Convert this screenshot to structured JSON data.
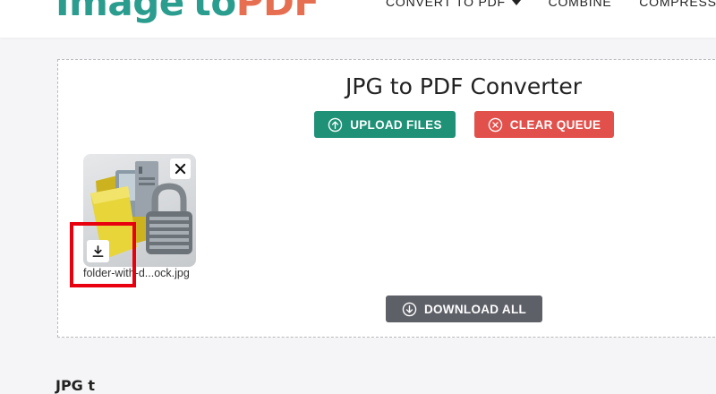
{
  "header": {
    "logo": {
      "part1": "Image",
      "part2": "to",
      "part3": "PDF"
    },
    "nav": [
      {
        "label": "CONVERT TO PDF"
      },
      {
        "label": "COMBINE"
      },
      {
        "label": "COMPRESS"
      }
    ]
  },
  "main": {
    "title": "JPG to PDF Converter",
    "upload_label": "UPLOAD FILES",
    "clear_label": "CLEAR QUEUE",
    "download_all_label": "DOWNLOAD ALL"
  },
  "files": [
    {
      "name": "folder-with-d...ock.jpg"
    }
  ],
  "footer": {
    "heading": "JPG t"
  },
  "colors": {
    "upload": "#1f9177",
    "clear": "#e2504c",
    "download": "#5e6068",
    "highlight": "#e8000e",
    "logo_teal": "#2a9d8f",
    "logo_orange": "#e76f51"
  },
  "icons": {
    "upload": "upload-circle-icon",
    "clear": "close-circle-icon",
    "download_all": "download-circle-icon",
    "remove": "close-icon",
    "file_download": "download-icon",
    "nav_caret": "chevron-down-icon"
  }
}
